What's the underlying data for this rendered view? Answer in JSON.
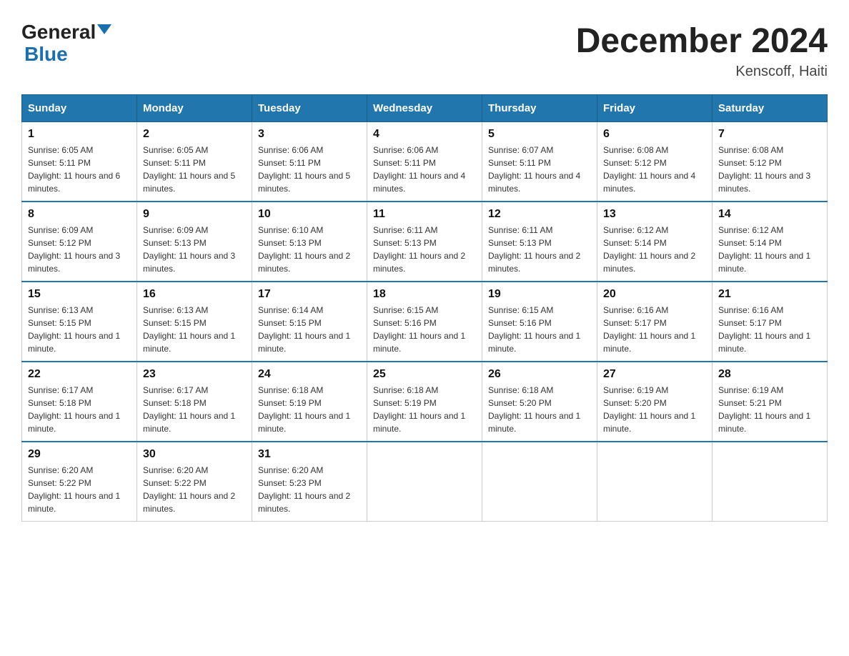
{
  "header": {
    "logo_general": "General",
    "logo_blue": "Blue",
    "month_title": "December 2024",
    "location": "Kenscoff, Haiti"
  },
  "weekdays": [
    "Sunday",
    "Monday",
    "Tuesday",
    "Wednesday",
    "Thursday",
    "Friday",
    "Saturday"
  ],
  "weeks": [
    [
      {
        "day": "1",
        "sunrise": "6:05 AM",
        "sunset": "5:11 PM",
        "daylight": "11 hours and 6 minutes."
      },
      {
        "day": "2",
        "sunrise": "6:05 AM",
        "sunset": "5:11 PM",
        "daylight": "11 hours and 5 minutes."
      },
      {
        "day": "3",
        "sunrise": "6:06 AM",
        "sunset": "5:11 PM",
        "daylight": "11 hours and 5 minutes."
      },
      {
        "day": "4",
        "sunrise": "6:06 AM",
        "sunset": "5:11 PM",
        "daylight": "11 hours and 4 minutes."
      },
      {
        "day": "5",
        "sunrise": "6:07 AM",
        "sunset": "5:11 PM",
        "daylight": "11 hours and 4 minutes."
      },
      {
        "day": "6",
        "sunrise": "6:08 AM",
        "sunset": "5:12 PM",
        "daylight": "11 hours and 4 minutes."
      },
      {
        "day": "7",
        "sunrise": "6:08 AM",
        "sunset": "5:12 PM",
        "daylight": "11 hours and 3 minutes."
      }
    ],
    [
      {
        "day": "8",
        "sunrise": "6:09 AM",
        "sunset": "5:12 PM",
        "daylight": "11 hours and 3 minutes."
      },
      {
        "day": "9",
        "sunrise": "6:09 AM",
        "sunset": "5:13 PM",
        "daylight": "11 hours and 3 minutes."
      },
      {
        "day": "10",
        "sunrise": "6:10 AM",
        "sunset": "5:13 PM",
        "daylight": "11 hours and 2 minutes."
      },
      {
        "day": "11",
        "sunrise": "6:11 AM",
        "sunset": "5:13 PM",
        "daylight": "11 hours and 2 minutes."
      },
      {
        "day": "12",
        "sunrise": "6:11 AM",
        "sunset": "5:13 PM",
        "daylight": "11 hours and 2 minutes."
      },
      {
        "day": "13",
        "sunrise": "6:12 AM",
        "sunset": "5:14 PM",
        "daylight": "11 hours and 2 minutes."
      },
      {
        "day": "14",
        "sunrise": "6:12 AM",
        "sunset": "5:14 PM",
        "daylight": "11 hours and 1 minute."
      }
    ],
    [
      {
        "day": "15",
        "sunrise": "6:13 AM",
        "sunset": "5:15 PM",
        "daylight": "11 hours and 1 minute."
      },
      {
        "day": "16",
        "sunrise": "6:13 AM",
        "sunset": "5:15 PM",
        "daylight": "11 hours and 1 minute."
      },
      {
        "day": "17",
        "sunrise": "6:14 AM",
        "sunset": "5:15 PM",
        "daylight": "11 hours and 1 minute."
      },
      {
        "day": "18",
        "sunrise": "6:15 AM",
        "sunset": "5:16 PM",
        "daylight": "11 hours and 1 minute."
      },
      {
        "day": "19",
        "sunrise": "6:15 AM",
        "sunset": "5:16 PM",
        "daylight": "11 hours and 1 minute."
      },
      {
        "day": "20",
        "sunrise": "6:16 AM",
        "sunset": "5:17 PM",
        "daylight": "11 hours and 1 minute."
      },
      {
        "day": "21",
        "sunrise": "6:16 AM",
        "sunset": "5:17 PM",
        "daylight": "11 hours and 1 minute."
      }
    ],
    [
      {
        "day": "22",
        "sunrise": "6:17 AM",
        "sunset": "5:18 PM",
        "daylight": "11 hours and 1 minute."
      },
      {
        "day": "23",
        "sunrise": "6:17 AM",
        "sunset": "5:18 PM",
        "daylight": "11 hours and 1 minute."
      },
      {
        "day": "24",
        "sunrise": "6:18 AM",
        "sunset": "5:19 PM",
        "daylight": "11 hours and 1 minute."
      },
      {
        "day": "25",
        "sunrise": "6:18 AM",
        "sunset": "5:19 PM",
        "daylight": "11 hours and 1 minute."
      },
      {
        "day": "26",
        "sunrise": "6:18 AM",
        "sunset": "5:20 PM",
        "daylight": "11 hours and 1 minute."
      },
      {
        "day": "27",
        "sunrise": "6:19 AM",
        "sunset": "5:20 PM",
        "daylight": "11 hours and 1 minute."
      },
      {
        "day": "28",
        "sunrise": "6:19 AM",
        "sunset": "5:21 PM",
        "daylight": "11 hours and 1 minute."
      }
    ],
    [
      {
        "day": "29",
        "sunrise": "6:20 AM",
        "sunset": "5:22 PM",
        "daylight": "11 hours and 1 minute."
      },
      {
        "day": "30",
        "sunrise": "6:20 AM",
        "sunset": "5:22 PM",
        "daylight": "11 hours and 2 minutes."
      },
      {
        "day": "31",
        "sunrise": "6:20 AM",
        "sunset": "5:23 PM",
        "daylight": "11 hours and 2 minutes."
      },
      null,
      null,
      null,
      null
    ]
  ]
}
